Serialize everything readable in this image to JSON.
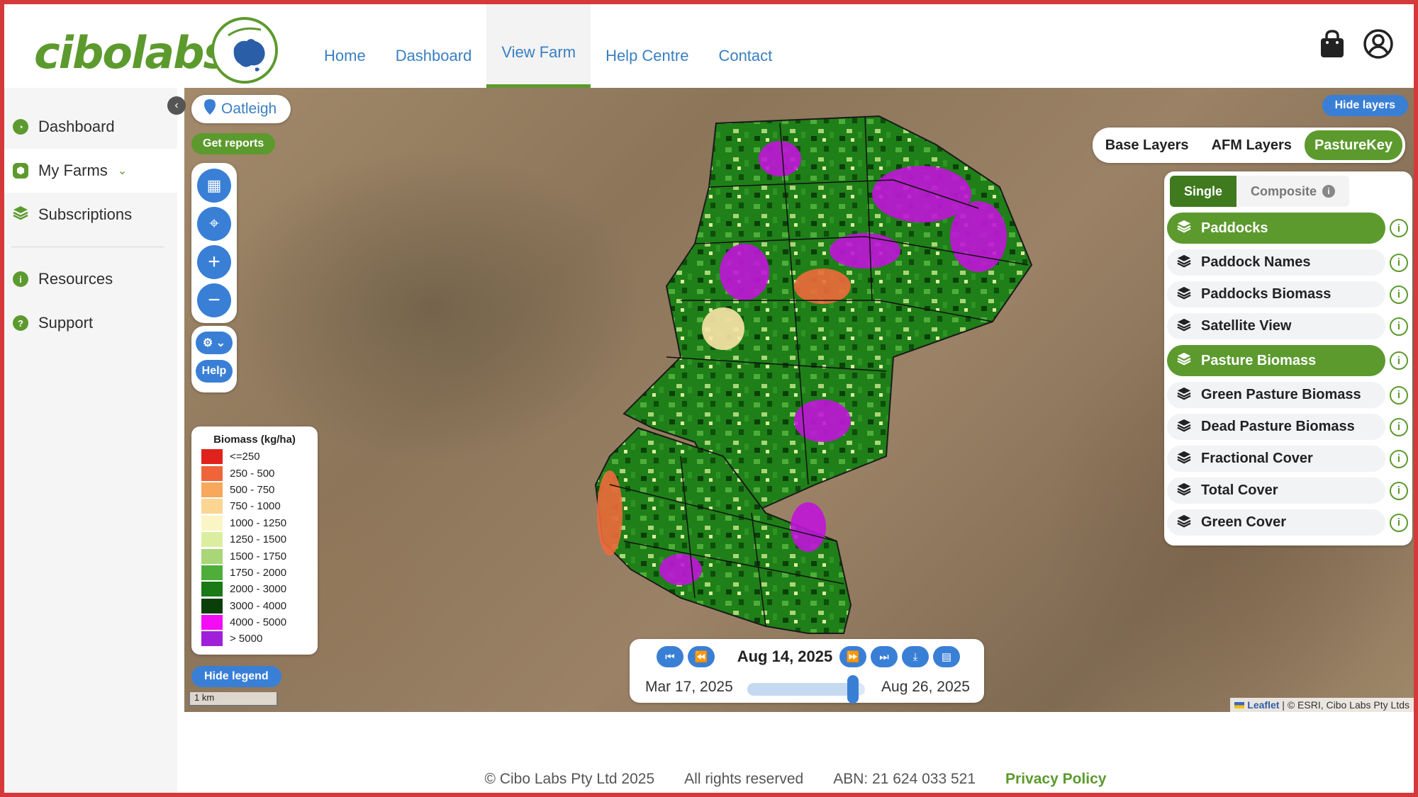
{
  "brand": {
    "logo_text": "cibolabs"
  },
  "nav": {
    "items": [
      {
        "label": "Home"
      },
      {
        "label": "Dashboard"
      },
      {
        "label": "View Farm"
      },
      {
        "label": "Help Centre"
      },
      {
        "label": "Contact"
      }
    ],
    "active": "View Farm"
  },
  "sidebar": {
    "items": [
      {
        "label": "Dashboard",
        "icon": "dashboard-icon"
      },
      {
        "label": "My Farms",
        "icon": "farm-icon"
      },
      {
        "label": "Subscriptions",
        "icon": "layers-icon"
      },
      {
        "label": "Resources",
        "icon": "info-icon"
      },
      {
        "label": "Support",
        "icon": "help-icon"
      }
    ],
    "active": "My Farms"
  },
  "map": {
    "farm_name": "Oatleigh",
    "get_reports": "Get reports",
    "help": "Help",
    "hide_legend": "Hide legend",
    "hide_layers": "Hide layers",
    "scale": "1 km",
    "attribution_leaflet": "Leaflet",
    "attribution_rest": "| © ESRI, Cibo Labs Pty Ltds"
  },
  "legend": {
    "title": "Biomass (kg/ha)",
    "entries": [
      {
        "label": "<=250",
        "color": "#e0221c"
      },
      {
        "label": "250 - 500",
        "color": "#f0643a"
      },
      {
        "label": "500 - 750",
        "color": "#f7a85a"
      },
      {
        "label": "750 - 1000",
        "color": "#fbd592"
      },
      {
        "label": "1000 - 1250",
        "color": "#fbf4c4"
      },
      {
        "label": "1250 - 1500",
        "color": "#dbeea0"
      },
      {
        "label": "1500 - 1750",
        "color": "#a9d676"
      },
      {
        "label": "1750 - 2000",
        "color": "#4fae3a"
      },
      {
        "label": "2000 - 3000",
        "color": "#1a7a16"
      },
      {
        "label": "3000 - 4000",
        "color": "#0b3f09"
      },
      {
        "label": "4000 - 5000",
        "color": "#f40cf4"
      },
      {
        "label": "> 5000",
        "color": "#a01fd8"
      }
    ]
  },
  "layer_tabs": {
    "tabs": [
      "Base Layers",
      "AFM Layers",
      "PastureKey"
    ],
    "active": "PastureKey"
  },
  "layers": {
    "modes": [
      "Single",
      "Composite"
    ],
    "active_mode": "Single",
    "items": [
      {
        "label": "Paddocks",
        "on": true
      },
      {
        "label": "Paddock Names",
        "on": false
      },
      {
        "label": "Paddocks Biomass",
        "on": false
      },
      {
        "label": "Satellite View",
        "on": false
      },
      {
        "label": "Pasture Biomass",
        "on": true
      },
      {
        "label": "Green Pasture Biomass",
        "on": false
      },
      {
        "label": "Dead Pasture Biomass",
        "on": false
      },
      {
        "label": "Fractional Cover",
        "on": false
      },
      {
        "label": "Total Cover",
        "on": false
      },
      {
        "label": "Green Cover",
        "on": false
      }
    ]
  },
  "timeline": {
    "current": "Aug 14, 2025",
    "start": "Mar 17, 2025",
    "end": "Aug 26, 2025",
    "position": 0.9
  },
  "footer": {
    "copyright": "© Cibo Labs Pty Ltd 2025",
    "rights": "All rights reserved",
    "abn": "ABN: 21 624 033 521",
    "privacy": "Privacy Policy"
  },
  "colors": {
    "brand_green": "#5c9a2e",
    "accent_blue": "#3a7fd6",
    "frame_red": "#d43a3a"
  }
}
